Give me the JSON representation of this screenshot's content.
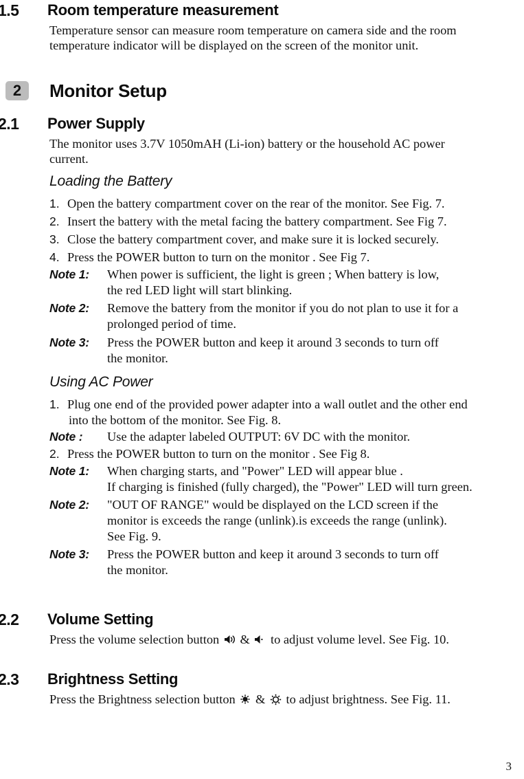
{
  "page": {
    "number": "3"
  },
  "section_1_5": {
    "number": "1.5",
    "title": "Room temperature measurement",
    "body_line_1": "Temperature sensor can measure room temperature on camera side and the room",
    "body_line_2": "temperature indicator will be displayed on the screen of the monitor unit."
  },
  "chapter_2": {
    "badge": "2",
    "title": "Monitor Setup"
  },
  "section_2_1": {
    "number": "2.1",
    "title": "Power Supply",
    "body_line_1": "The monitor uses 3.7V 1050mAH (Li-ion) battery or the household AC power",
    "body_line_2": "current.",
    "loading_battery": {
      "heading": "Loading the Battery",
      "steps": [
        {
          "marker": "1.",
          "text": "Open the battery compartment cover on the rear of the monitor.  See Fig. 7."
        },
        {
          "marker": "2.",
          "text": "Insert the battery with the metal facing the battery compartment.  See Fig 7."
        },
        {
          "marker": "3.",
          "text": "Close the battery compartment cover, and make sure it is locked securely."
        },
        {
          "marker": "4.",
          "text": "Press the POWER button to turn on the monitor .  See Fig 7."
        }
      ],
      "notes": [
        {
          "label": "Note 1:",
          "line_1": "When power is sufficient, the light is green ; When battery is low,",
          "line_2": "the red LED light will start blinking."
        },
        {
          "label": "Note 2:",
          "line_1": "Remove the battery from the monitor if you do not plan to use it for a",
          "line_2": "prolonged period of time."
        },
        {
          "label": "Note 3:",
          "line_1": "Press the POWER button and keep it around 3 seconds to turn off",
          "line_2": "the monitor."
        }
      ]
    },
    "using_ac_power": {
      "heading": "Using AC Power",
      "step_1_marker": "1.",
      "step_1_line_1": "Plug one end of the provided power adapter into a wall outlet and the other end",
      "step_1_line_2": "into the bottom of the monitor.  See Fig. 8.",
      "note_plain_label": "Note :",
      "note_plain_text": "Use the adapter labeled OUTPUT: 6V DC with the monitor.",
      "step_2_marker": "2.",
      "step_2_text": "Press the POWER button to turn on the monitor .  See Fig 8.",
      "notes": [
        {
          "label": "Note 1:",
          "line_1": "When charging starts, and \"Power\" LED will appear blue .",
          "line_2": "If charging is finished (fully charged), the \"Power\" LED will turn green.",
          "line_3": ""
        },
        {
          "label": "Note 2:",
          "line_1": "\"OUT OF RANGE\" would be displayed on the LCD screen if the",
          "line_2": "monitor is exceeds the range (unlink).is exceeds the range (unlink).",
          "line_3": "See Fig. 9."
        },
        {
          "label": "Note 3:",
          "line_1": "Press the POWER button and keep it around 3 seconds to turn off",
          "line_2": "the monitor.",
          "line_3": ""
        }
      ]
    }
  },
  "section_2_2": {
    "number": "2.2",
    "title": "Volume Setting",
    "text_before_icon_1": "Press the volume selection button",
    "icon_1": "volume-up-icon",
    "ampersand": "&",
    "icon_2": "volume-down-icon",
    "text_after_icons": "to adjust volume level. See Fig. 10."
  },
  "section_2_3": {
    "number": "2.3",
    "title": "Brightness Setting",
    "text_before_icon_1": "Press the Brightness selection button",
    "icon_1": "brightness-low-icon",
    "ampersand": "&",
    "icon_2": "brightness-high-icon",
    "text_after_icons": "to adjust brightness.  See Fig. 11."
  },
  "colors": {
    "text": "#121212",
    "badge_background": "#bcbcbc",
    "page_background": "#ffffff"
  }
}
